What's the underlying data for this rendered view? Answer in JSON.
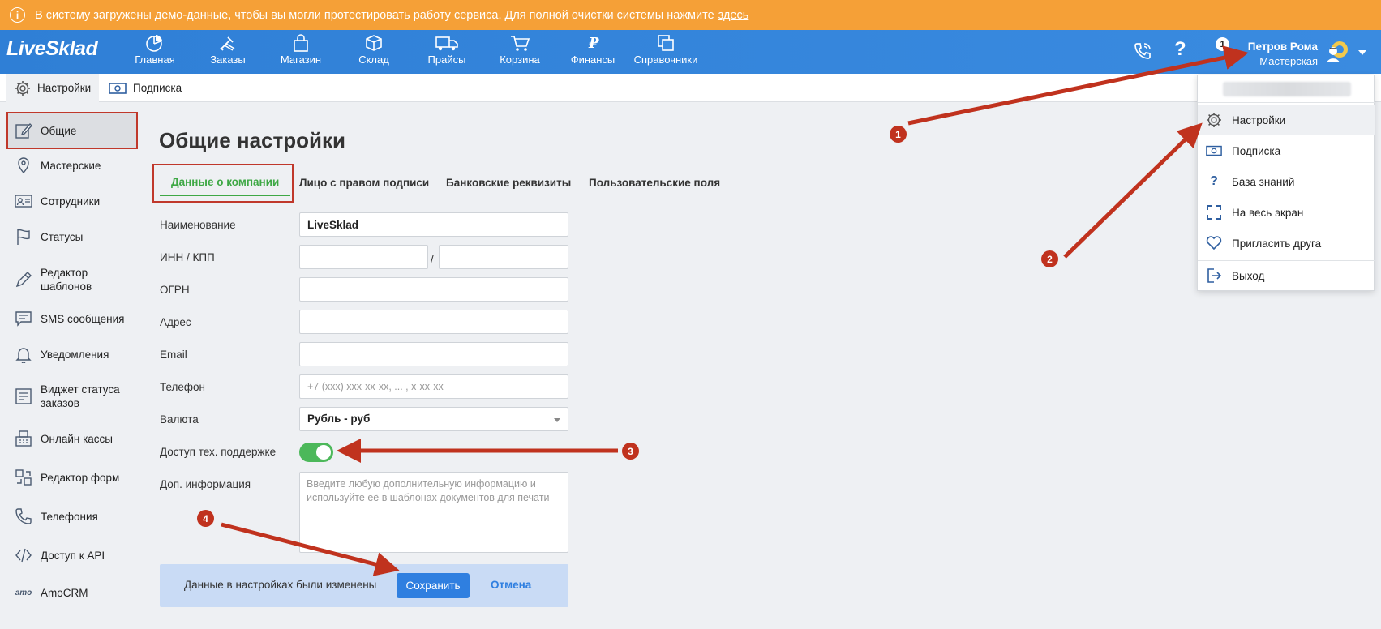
{
  "banner": {
    "text": "В систему загружены демо-данные, чтобы вы могли протестировать работу сервиса. Для полной очистки системы нажмите",
    "link": "здесь"
  },
  "topnav": {
    "logo": "LiveSklad",
    "items": [
      {
        "label": "Главная",
        "icon": "pie-chart-icon"
      },
      {
        "label": "Заказы",
        "icon": "wrench-icon"
      },
      {
        "label": "Магазин",
        "icon": "shopping-bag-icon"
      },
      {
        "label": "Склад",
        "icon": "box-icon"
      },
      {
        "label": "Прайсы",
        "icon": "truck-icon"
      },
      {
        "label": "Корзина",
        "icon": "cart-icon"
      },
      {
        "label": "Финансы",
        "icon": "ruble-icon"
      },
      {
        "label": "Справочники",
        "icon": "copy-icon"
      }
    ],
    "notification_count": "1",
    "user_name": "Петров Рома",
    "user_role": "Мастерская"
  },
  "subnav": {
    "tabs": [
      "Настройки",
      "Подписка"
    ]
  },
  "sidebar": {
    "items": [
      {
        "label": "Общие",
        "icon": "edit-icon"
      },
      {
        "label": "Мастерские",
        "icon": "location-pin-icon"
      },
      {
        "label": "Сотрудники",
        "icon": "id-card-icon"
      },
      {
        "label": "Статусы",
        "icon": "flag-icon"
      },
      {
        "label": "Редактор шаблонов",
        "icon": "pencil-icon"
      },
      {
        "label": "SMS сообщения",
        "icon": "message-icon"
      },
      {
        "label": "Уведомления",
        "icon": "bell-icon"
      },
      {
        "label": "Виджет статуса заказов",
        "icon": "widget-icon"
      },
      {
        "label": "Онлайн кассы",
        "icon": "cash-register-icon"
      },
      {
        "label": "Редактор форм",
        "icon": "form-editor-icon"
      },
      {
        "label": "Телефония",
        "icon": "phone-icon"
      },
      {
        "label": "Доступ к API",
        "icon": "code-icon"
      },
      {
        "label": "AmoCRM",
        "icon": "amocrm-logo-icon"
      }
    ]
  },
  "main": {
    "title": "Общие настройки",
    "tabs": [
      "Данные о компании",
      "Лицо с правом подписи",
      "Банковские реквизиты",
      "Пользовательские поля"
    ],
    "form": {
      "name_label": "Наименование",
      "name_value": "LiveSklad",
      "inn_label": "ИНН / КПП",
      "inn_value": "",
      "kpp_value": "",
      "ogrn_label": "ОГРН",
      "ogrn_value": "",
      "address_label": "Адрес",
      "address_value": "",
      "email_label": "Email",
      "email_value": "",
      "phone_label": "Телефон",
      "phone_placeholder": "+7 (xxx) xxx-xx-xx, ... , x-xx-xx",
      "currency_label": "Валюта",
      "currency_value": "Рубль - руб",
      "support_label": "Доступ тех. поддержке",
      "support_enabled": true,
      "extra_label": "Доп. информация",
      "extra_placeholder": "Введите любую дополнительную информацию и используйте её в шаблонах документов для печати"
    },
    "save_bar": {
      "message": "Данные в настройках были изменены",
      "save_label": "Сохранить",
      "cancel_label": "Отмена"
    }
  },
  "dropdown": {
    "items": [
      {
        "label": "Настройки",
        "icon": "gear-icon"
      },
      {
        "label": "Подписка",
        "icon": "banknote-icon"
      },
      {
        "label": "База знаний",
        "icon": "question-icon"
      },
      {
        "label": "На весь экран",
        "icon": "fullscreen-icon"
      },
      {
        "label": "Пригласить друга",
        "icon": "heart-icon"
      },
      {
        "label": "Выход",
        "icon": "logout-icon"
      }
    ]
  },
  "callouts": [
    "1",
    "2",
    "3",
    "4"
  ],
  "colors": {
    "banner": "#f5a037",
    "nav": "#2f7fd6",
    "accent_green": "#3ea845",
    "annotation_red": "#c0321e",
    "primary_button": "#2f7fe0"
  }
}
